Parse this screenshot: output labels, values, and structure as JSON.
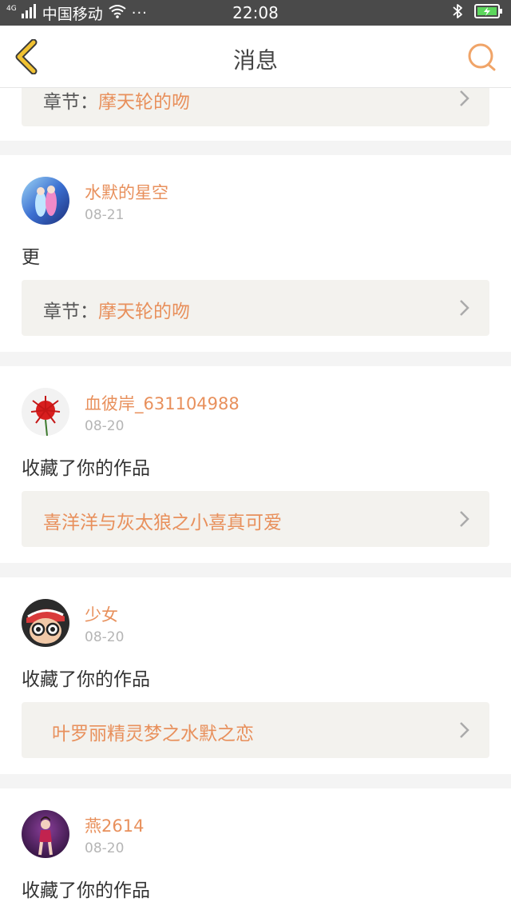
{
  "status_bar": {
    "network_tag": "4G",
    "carrier": "中国移动",
    "more": "···",
    "time": "22:08"
  },
  "header": {
    "title": "消息"
  },
  "colors": {
    "accent": "#e8905c",
    "back_icon": "#f1c232",
    "search_icon": "#f0a468",
    "link_bg": "#f3f2ee"
  },
  "partial_item": {
    "link_prefix": "章节：",
    "link_title": "摩天轮的吻"
  },
  "messages": [
    {
      "username": "水默的星空",
      "date": "08-21",
      "text": "更",
      "link_prefix": "章节：",
      "link_title": "摩天轮的吻"
    },
    {
      "username": "血彼岸_631104988",
      "date": "08-20",
      "text": "收藏了你的作品",
      "link_prefix": "",
      "link_title": "喜洋洋与灰太狼之小喜真可爱"
    },
    {
      "username": "少女",
      "date": "08-20",
      "text": "收藏了你的作品",
      "link_prefix": "",
      "link_title": "叶罗丽精灵梦之水默之恋"
    },
    {
      "username": "燕2614",
      "date": "08-20",
      "text": "收藏了你的作品"
    }
  ]
}
